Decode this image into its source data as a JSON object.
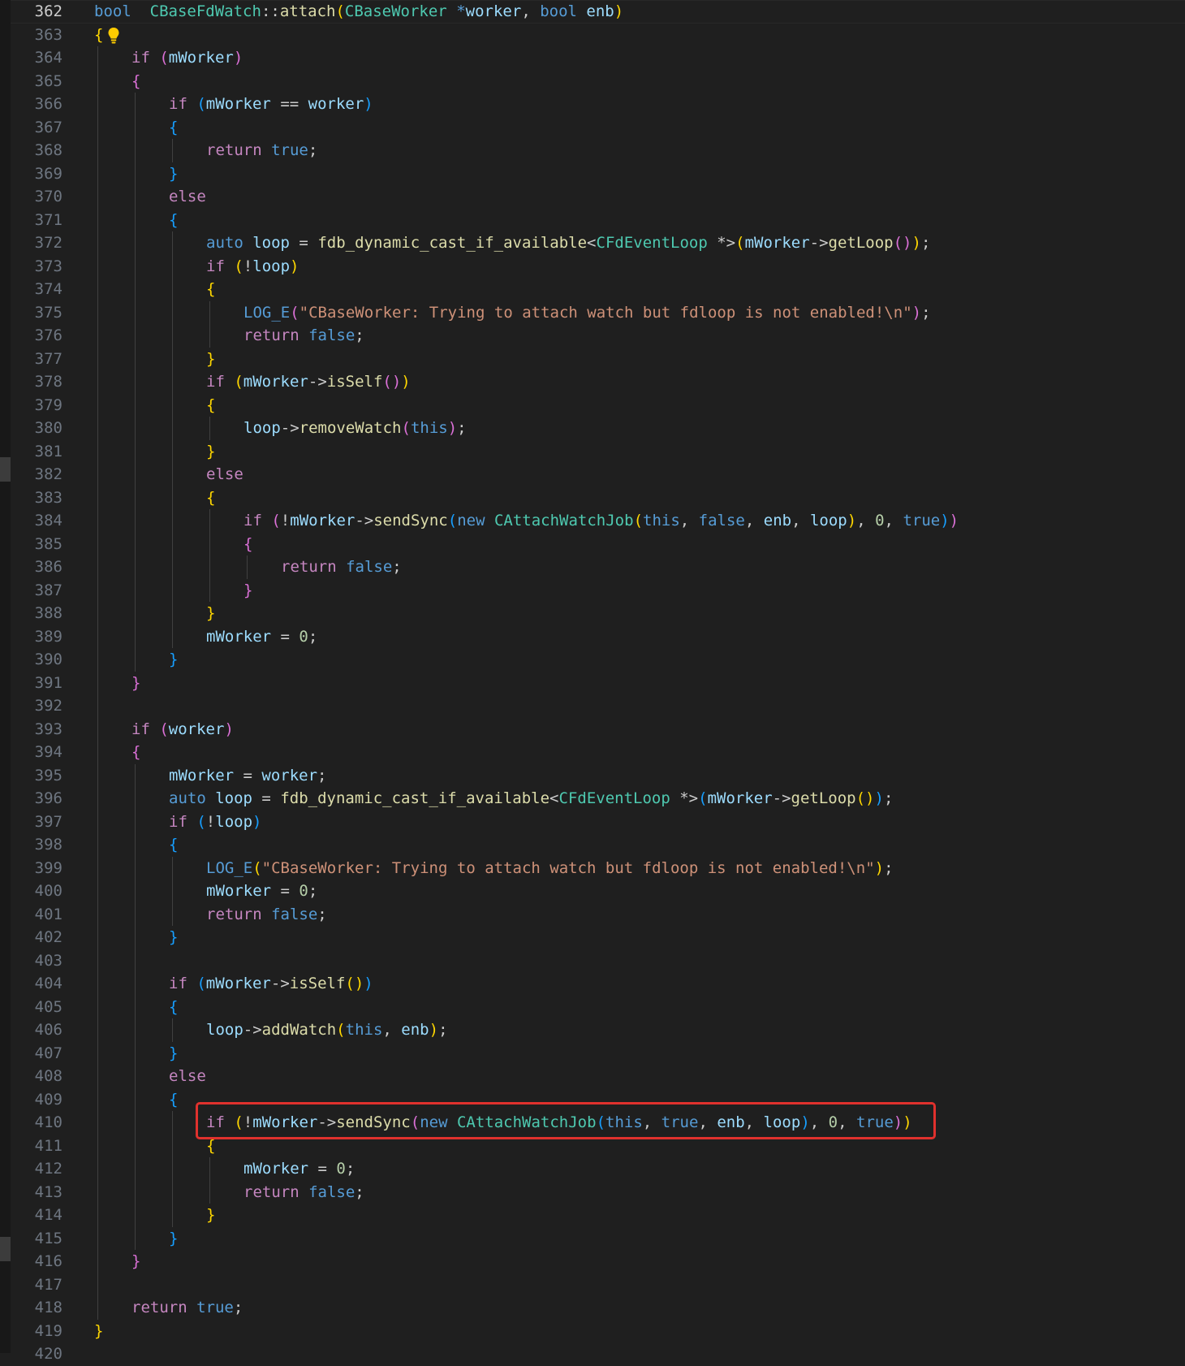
{
  "editor": {
    "active_line": 362,
    "highlighted_line": 410,
    "lines": [
      {
        "n": 362,
        "indent": 0,
        "tokens": [
          [
            "kw",
            "bool"
          ],
          [
            "",
            "  "
          ],
          [
            "ty",
            "CBaseFdWatch"
          ],
          [
            "",
            "::"
          ],
          [
            "fn",
            "attach"
          ],
          [
            "b1",
            "("
          ],
          [
            "ty",
            "CBaseWorker"
          ],
          [
            "",
            " "
          ],
          [
            "kw",
            "*"
          ],
          [
            "var",
            "worker"
          ],
          [
            "",
            ", "
          ],
          [
            "kw",
            "bool"
          ],
          [
            "",
            " "
          ],
          [
            "var",
            "enb"
          ],
          [
            "b1",
            ")"
          ]
        ]
      },
      {
        "n": 363,
        "indent": 0,
        "tokens": [
          [
            "b1",
            "{"
          ]
        ]
      },
      {
        "n": 364,
        "indent": 1,
        "tokens": [
          [
            "ctl",
            "if"
          ],
          [
            "",
            " "
          ],
          [
            "b2",
            "("
          ],
          [
            "var",
            "mWorker"
          ],
          [
            "b2",
            ")"
          ]
        ]
      },
      {
        "n": 365,
        "indent": 1,
        "tokens": [
          [
            "b2",
            "{"
          ]
        ]
      },
      {
        "n": 366,
        "indent": 2,
        "tokens": [
          [
            "ctl",
            "if"
          ],
          [
            "",
            " "
          ],
          [
            "b3",
            "("
          ],
          [
            "var",
            "mWorker"
          ],
          [
            "",
            " == "
          ],
          [
            "var",
            "worker"
          ],
          [
            "b3",
            ")"
          ]
        ]
      },
      {
        "n": 367,
        "indent": 2,
        "tokens": [
          [
            "b3",
            "{"
          ]
        ]
      },
      {
        "n": 368,
        "indent": 3,
        "tokens": [
          [
            "ctl",
            "return"
          ],
          [
            "",
            " "
          ],
          [
            "kw",
            "true"
          ],
          [
            "",
            ";"
          ]
        ]
      },
      {
        "n": 369,
        "indent": 2,
        "tokens": [
          [
            "b3",
            "}"
          ]
        ]
      },
      {
        "n": 370,
        "indent": 2,
        "tokens": [
          [
            "ctl",
            "else"
          ]
        ]
      },
      {
        "n": 371,
        "indent": 2,
        "tokens": [
          [
            "b3",
            "{"
          ]
        ]
      },
      {
        "n": 372,
        "indent": 3,
        "tokens": [
          [
            "kw",
            "auto"
          ],
          [
            "",
            " "
          ],
          [
            "var",
            "loop"
          ],
          [
            "",
            " = "
          ],
          [
            "fn",
            "fdb_dynamic_cast_if_available"
          ],
          [
            "",
            "<"
          ],
          [
            "ty",
            "CFdEventLoop"
          ],
          [
            "",
            " *>"
          ],
          [
            "b1",
            "("
          ],
          [
            "var",
            "mWorker"
          ],
          [
            "",
            "->"
          ],
          [
            "fn",
            "getLoop"
          ],
          [
            "b2",
            "()"
          ],
          [
            "b1",
            ")"
          ],
          [
            "",
            ";"
          ]
        ]
      },
      {
        "n": 373,
        "indent": 3,
        "tokens": [
          [
            "ctl",
            "if"
          ],
          [
            "",
            " "
          ],
          [
            "b1",
            "("
          ],
          [
            "",
            "!"
          ],
          [
            "var",
            "loop"
          ],
          [
            "b1",
            ")"
          ]
        ]
      },
      {
        "n": 374,
        "indent": 3,
        "tokens": [
          [
            "b1",
            "{"
          ]
        ]
      },
      {
        "n": 375,
        "indent": 4,
        "tokens": [
          [
            "mac",
            "LOG_E"
          ],
          [
            "b2",
            "("
          ],
          [
            "str",
            "\"CBaseWorker: Trying to attach watch but fdloop is not enabled!\\n\""
          ],
          [
            "b2",
            ")"
          ],
          [
            "",
            ";"
          ]
        ]
      },
      {
        "n": 376,
        "indent": 4,
        "tokens": [
          [
            "ctl",
            "return"
          ],
          [
            "",
            " "
          ],
          [
            "kw",
            "false"
          ],
          [
            "",
            ";"
          ]
        ]
      },
      {
        "n": 377,
        "indent": 3,
        "tokens": [
          [
            "b1",
            "}"
          ]
        ]
      },
      {
        "n": 378,
        "indent": 3,
        "tokens": [
          [
            "ctl",
            "if"
          ],
          [
            "",
            " "
          ],
          [
            "b1",
            "("
          ],
          [
            "var",
            "mWorker"
          ],
          [
            "",
            "->"
          ],
          [
            "fn",
            "isSelf"
          ],
          [
            "b2",
            "()"
          ],
          [
            "b1",
            ")"
          ]
        ]
      },
      {
        "n": 379,
        "indent": 3,
        "tokens": [
          [
            "b1",
            "{"
          ]
        ]
      },
      {
        "n": 380,
        "indent": 4,
        "tokens": [
          [
            "var",
            "loop"
          ],
          [
            "",
            "->"
          ],
          [
            "fn",
            "removeWatch"
          ],
          [
            "b2",
            "("
          ],
          [
            "kw",
            "this"
          ],
          [
            "b2",
            ")"
          ],
          [
            "",
            ";"
          ]
        ]
      },
      {
        "n": 381,
        "indent": 3,
        "tokens": [
          [
            "b1",
            "}"
          ]
        ]
      },
      {
        "n": 382,
        "indent": 3,
        "tokens": [
          [
            "ctl",
            "else"
          ]
        ]
      },
      {
        "n": 383,
        "indent": 3,
        "tokens": [
          [
            "b1",
            "{"
          ]
        ]
      },
      {
        "n": 384,
        "indent": 4,
        "tokens": [
          [
            "ctl",
            "if"
          ],
          [
            "",
            " "
          ],
          [
            "b2",
            "("
          ],
          [
            "",
            "!"
          ],
          [
            "var",
            "mWorker"
          ],
          [
            "",
            "->"
          ],
          [
            "fn",
            "sendSync"
          ],
          [
            "b3",
            "("
          ],
          [
            "kw",
            "new"
          ],
          [
            "",
            " "
          ],
          [
            "ty",
            "CAttachWatchJob"
          ],
          [
            "b1",
            "("
          ],
          [
            "kw",
            "this"
          ],
          [
            "",
            ", "
          ],
          [
            "kw",
            "false"
          ],
          [
            "",
            ", "
          ],
          [
            "var",
            "enb"
          ],
          [
            "",
            ", "
          ],
          [
            "var",
            "loop"
          ],
          [
            "b1",
            ")"
          ],
          [
            "",
            ", "
          ],
          [
            "num",
            "0"
          ],
          [
            "",
            ", "
          ],
          [
            "kw",
            "true"
          ],
          [
            "b3",
            ")"
          ],
          [
            "b2",
            ")"
          ]
        ]
      },
      {
        "n": 385,
        "indent": 4,
        "tokens": [
          [
            "b2",
            "{"
          ]
        ]
      },
      {
        "n": 386,
        "indent": 5,
        "tokens": [
          [
            "ctl",
            "return"
          ],
          [
            "",
            " "
          ],
          [
            "kw",
            "false"
          ],
          [
            "",
            ";"
          ]
        ]
      },
      {
        "n": 387,
        "indent": 4,
        "tokens": [
          [
            "b2",
            "}"
          ]
        ]
      },
      {
        "n": 388,
        "indent": 3,
        "tokens": [
          [
            "b1",
            "}"
          ]
        ]
      },
      {
        "n": 389,
        "indent": 3,
        "tokens": [
          [
            "var",
            "mWorker"
          ],
          [
            "",
            " = "
          ],
          [
            "num",
            "0"
          ],
          [
            "",
            ";"
          ]
        ]
      },
      {
        "n": 390,
        "indent": 2,
        "tokens": [
          [
            "b3",
            "}"
          ]
        ]
      },
      {
        "n": 391,
        "indent": 1,
        "tokens": [
          [
            "b2",
            "}"
          ]
        ]
      },
      {
        "n": 392,
        "indent": 0,
        "tokens": []
      },
      {
        "n": 393,
        "indent": 1,
        "tokens": [
          [
            "ctl",
            "if"
          ],
          [
            "",
            " "
          ],
          [
            "b2",
            "("
          ],
          [
            "var",
            "worker"
          ],
          [
            "b2",
            ")"
          ]
        ]
      },
      {
        "n": 394,
        "indent": 1,
        "tokens": [
          [
            "b2",
            "{"
          ]
        ]
      },
      {
        "n": 395,
        "indent": 2,
        "tokens": [
          [
            "var",
            "mWorker"
          ],
          [
            "",
            " = "
          ],
          [
            "var",
            "worker"
          ],
          [
            "",
            ";"
          ]
        ]
      },
      {
        "n": 396,
        "indent": 2,
        "tokens": [
          [
            "kw",
            "auto"
          ],
          [
            "",
            " "
          ],
          [
            "var",
            "loop"
          ],
          [
            "",
            " = "
          ],
          [
            "fn",
            "fdb_dynamic_cast_if_available"
          ],
          [
            "",
            "<"
          ],
          [
            "ty",
            "CFdEventLoop"
          ],
          [
            "",
            " *>"
          ],
          [
            "b3",
            "("
          ],
          [
            "var",
            "mWorker"
          ],
          [
            "",
            "->"
          ],
          [
            "fn",
            "getLoop"
          ],
          [
            "b1",
            "()"
          ],
          [
            "b3",
            ")"
          ],
          [
            "",
            ";"
          ]
        ]
      },
      {
        "n": 397,
        "indent": 2,
        "tokens": [
          [
            "ctl",
            "if"
          ],
          [
            "",
            " "
          ],
          [
            "b3",
            "("
          ],
          [
            "",
            "!"
          ],
          [
            "var",
            "loop"
          ],
          [
            "b3",
            ")"
          ]
        ]
      },
      {
        "n": 398,
        "indent": 2,
        "tokens": [
          [
            "b3",
            "{"
          ]
        ]
      },
      {
        "n": 399,
        "indent": 3,
        "tokens": [
          [
            "mac",
            "LOG_E"
          ],
          [
            "b1",
            "("
          ],
          [
            "str",
            "\"CBaseWorker: Trying to attach watch but fdloop is not enabled!\\n\""
          ],
          [
            "b1",
            ")"
          ],
          [
            "",
            ";"
          ]
        ]
      },
      {
        "n": 400,
        "indent": 3,
        "tokens": [
          [
            "var",
            "mWorker"
          ],
          [
            "",
            " = "
          ],
          [
            "num",
            "0"
          ],
          [
            "",
            ";"
          ]
        ]
      },
      {
        "n": 401,
        "indent": 3,
        "tokens": [
          [
            "ctl",
            "return"
          ],
          [
            "",
            " "
          ],
          [
            "kw",
            "false"
          ],
          [
            "",
            ";"
          ]
        ]
      },
      {
        "n": 402,
        "indent": 2,
        "tokens": [
          [
            "b3",
            "}"
          ]
        ]
      },
      {
        "n": 403,
        "indent": 0,
        "tokens": []
      },
      {
        "n": 404,
        "indent": 2,
        "tokens": [
          [
            "ctl",
            "if"
          ],
          [
            "",
            " "
          ],
          [
            "b3",
            "("
          ],
          [
            "var",
            "mWorker"
          ],
          [
            "",
            "->"
          ],
          [
            "fn",
            "isSelf"
          ],
          [
            "b1",
            "()"
          ],
          [
            "b3",
            ")"
          ]
        ]
      },
      {
        "n": 405,
        "indent": 2,
        "tokens": [
          [
            "b3",
            "{"
          ]
        ]
      },
      {
        "n": 406,
        "indent": 3,
        "tokens": [
          [
            "var",
            "loop"
          ],
          [
            "",
            "->"
          ],
          [
            "fn",
            "addWatch"
          ],
          [
            "b1",
            "("
          ],
          [
            "kw",
            "this"
          ],
          [
            "",
            ", "
          ],
          [
            "var",
            "enb"
          ],
          [
            "b1",
            ")"
          ],
          [
            "",
            ";"
          ]
        ]
      },
      {
        "n": 407,
        "indent": 2,
        "tokens": [
          [
            "b3",
            "}"
          ]
        ]
      },
      {
        "n": 408,
        "indent": 2,
        "tokens": [
          [
            "ctl",
            "else"
          ]
        ]
      },
      {
        "n": 409,
        "indent": 2,
        "tokens": [
          [
            "b3",
            "{"
          ]
        ]
      },
      {
        "n": 410,
        "indent": 3,
        "tokens": [
          [
            "ctl",
            "if"
          ],
          [
            "",
            " "
          ],
          [
            "b1",
            "("
          ],
          [
            "",
            "!"
          ],
          [
            "var",
            "mWorker"
          ],
          [
            "",
            "->"
          ],
          [
            "fn",
            "sendSync"
          ],
          [
            "b2",
            "("
          ],
          [
            "kw",
            "new"
          ],
          [
            "",
            " "
          ],
          [
            "ty",
            "CAttachWatchJob"
          ],
          [
            "b3",
            "("
          ],
          [
            "kw",
            "this"
          ],
          [
            "",
            ", "
          ],
          [
            "kw",
            "true"
          ],
          [
            "",
            ", "
          ],
          [
            "var",
            "enb"
          ],
          [
            "",
            ", "
          ],
          [
            "var",
            "loop"
          ],
          [
            "b3",
            ")"
          ],
          [
            "",
            ", "
          ],
          [
            "num",
            "0"
          ],
          [
            "",
            ", "
          ],
          [
            "kw",
            "true"
          ],
          [
            "b2",
            ")"
          ],
          [
            "b1",
            ")"
          ]
        ]
      },
      {
        "n": 411,
        "indent": 3,
        "tokens": [
          [
            "b1",
            "{"
          ]
        ]
      },
      {
        "n": 412,
        "indent": 4,
        "tokens": [
          [
            "var",
            "mWorker"
          ],
          [
            "",
            " = "
          ],
          [
            "num",
            "0"
          ],
          [
            "",
            ";"
          ]
        ]
      },
      {
        "n": 413,
        "indent": 4,
        "tokens": [
          [
            "ctl",
            "return"
          ],
          [
            "",
            " "
          ],
          [
            "kw",
            "false"
          ],
          [
            "",
            ";"
          ]
        ]
      },
      {
        "n": 414,
        "indent": 3,
        "tokens": [
          [
            "b1",
            "}"
          ]
        ]
      },
      {
        "n": 415,
        "indent": 2,
        "tokens": [
          [
            "b3",
            "}"
          ]
        ]
      },
      {
        "n": 416,
        "indent": 1,
        "tokens": [
          [
            "b2",
            "}"
          ]
        ]
      },
      {
        "n": 417,
        "indent": 0,
        "tokens": []
      },
      {
        "n": 418,
        "indent": 1,
        "tokens": [
          [
            "ctl",
            "return"
          ],
          [
            "",
            " "
          ],
          [
            "kw",
            "true"
          ],
          [
            "",
            ";"
          ]
        ]
      },
      {
        "n": 419,
        "indent": 0,
        "tokens": [
          [
            "b1",
            "}"
          ]
        ]
      },
      {
        "n": 420,
        "indent": 0,
        "tokens": []
      }
    ]
  },
  "colors": {
    "background": "#1f1f1f",
    "line_number": "#6e7681",
    "line_number_active": "#cccccc",
    "highlight_box": "#e0312d",
    "bulb": "#ffcc00"
  },
  "icons": {
    "lightbulb": "lightbulb-icon"
  }
}
